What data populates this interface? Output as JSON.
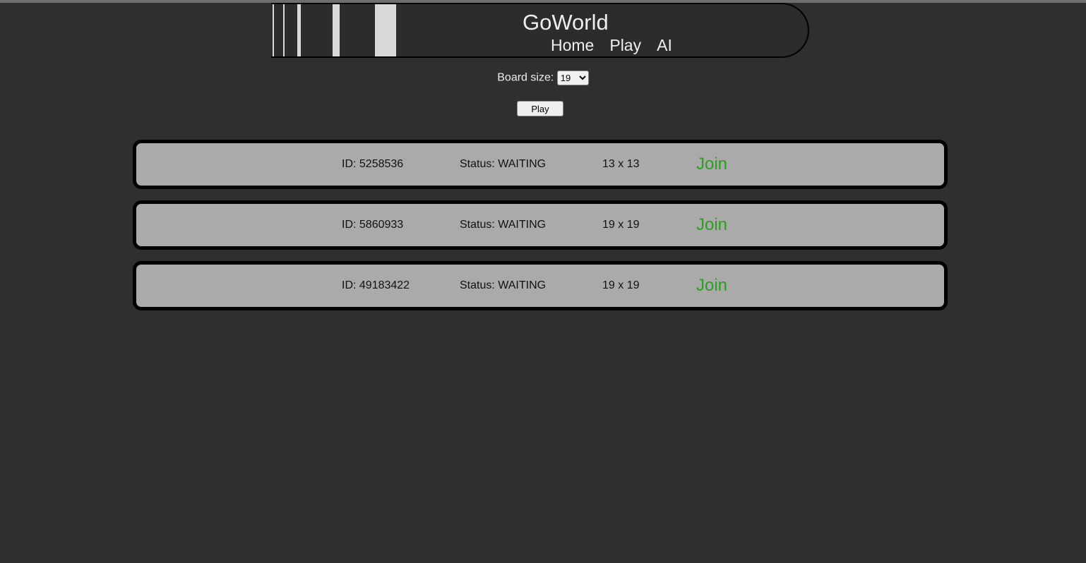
{
  "header": {
    "title": "GoWorld",
    "nav": [
      "Home",
      "Play",
      "AI"
    ]
  },
  "board": {
    "label": "Board size:",
    "selected": "19",
    "play_label": "Play"
  },
  "games": [
    {
      "id": "ID: 5258536",
      "status": "Status: WAITING",
      "size": "13 x 13",
      "join": "Join"
    },
    {
      "id": "ID: 5860933",
      "status": "Status: WAITING",
      "size": "19 x 19",
      "join": "Join"
    },
    {
      "id": "ID: 49183422",
      "status": "Status: WAITING",
      "size": "19 x 19",
      "join": "Join"
    }
  ],
  "colors": {
    "background": "#302f30",
    "card": "#aaaaaa",
    "join": "#2aa01e"
  }
}
